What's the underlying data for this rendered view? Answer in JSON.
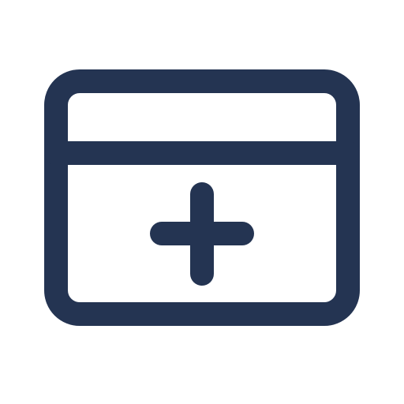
{
  "icon": {
    "name": "window-add-icon",
    "stroke_color": "#243452"
  }
}
